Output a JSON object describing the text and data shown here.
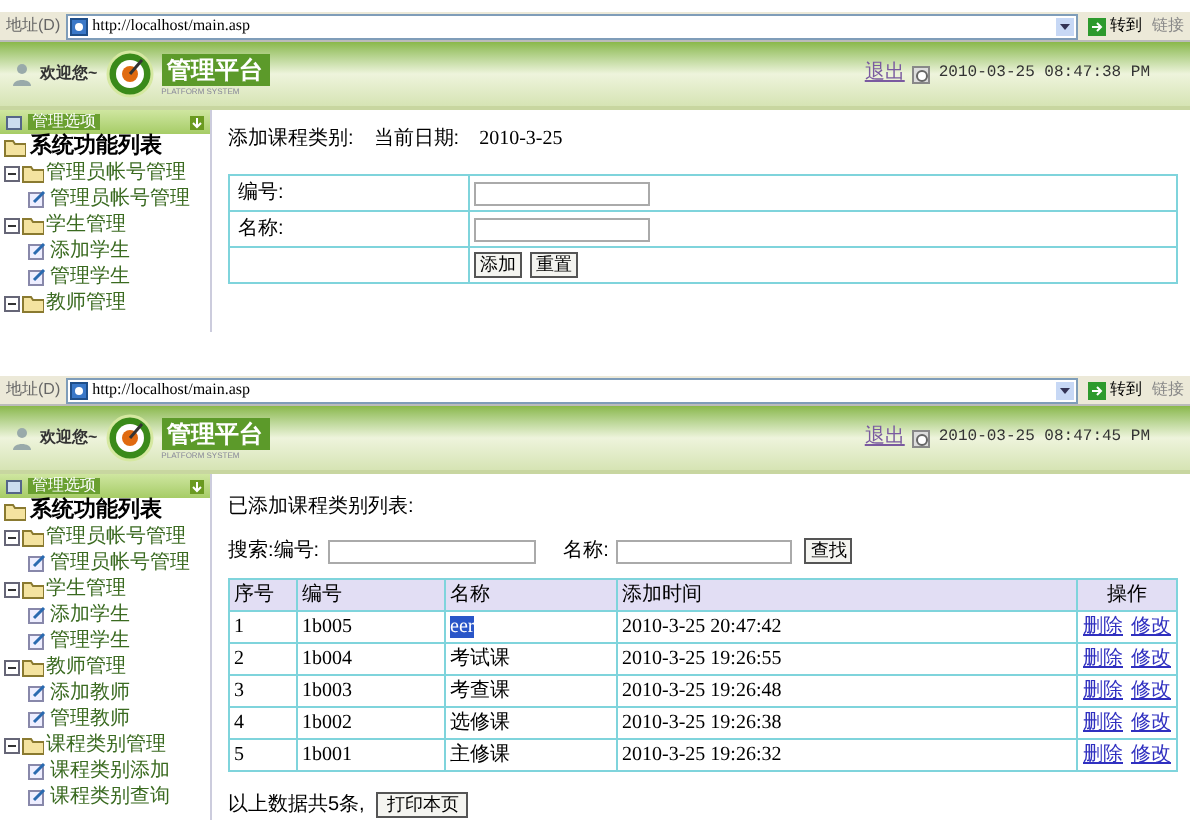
{
  "screens": [
    {
      "address_label": "地址(D)",
      "url": "http://localhost/main.asp",
      "go_label": "转到",
      "links_label": "链接",
      "welcome": "欢迎您~",
      "logo_text": "管理平台",
      "logo_subtitle": "PLATFORM SYSTEM",
      "logout": "退出",
      "datetime": "2010-03-25 08:47:38 PM",
      "sidebar": {
        "header": "管理选项",
        "title": "系统功能列表",
        "groups": [
          {
            "label": "管理员帐号管理",
            "expanded": true,
            "children": [
              {
                "label": "管理员帐号管理"
              }
            ]
          },
          {
            "label": "学生管理",
            "expanded": true,
            "children": [
              {
                "label": "添加学生"
              },
              {
                "label": "管理学生"
              }
            ]
          },
          {
            "label": "教师管理",
            "expanded": true
          }
        ]
      },
      "content": {
        "kind": "form",
        "title": "添加课程类别:",
        "date_label": "当前日期:",
        "date": "2010-3-25",
        "fields": [
          {
            "label": "编号:"
          },
          {
            "label": "名称:"
          }
        ],
        "buttons": [
          "添加",
          "重置"
        ]
      }
    },
    {
      "address_label": "地址(D)",
      "url": "http://localhost/main.asp",
      "go_label": "转到",
      "links_label": "链接",
      "welcome": "欢迎您~",
      "logo_text": "管理平台",
      "logo_subtitle": "PLATFORM SYSTEM",
      "logout": "退出",
      "datetime": "2010-03-25 08:47:45 PM",
      "sidebar": {
        "header": "管理选项",
        "title": "系统功能列表",
        "groups": [
          {
            "label": "管理员帐号管理",
            "expanded": true,
            "children": [
              {
                "label": "管理员帐号管理"
              }
            ]
          },
          {
            "label": "学生管理",
            "expanded": true,
            "children": [
              {
                "label": "添加学生"
              },
              {
                "label": "管理学生"
              }
            ]
          },
          {
            "label": "教师管理",
            "expanded": true,
            "children": [
              {
                "label": "添加教师"
              },
              {
                "label": "管理教师"
              }
            ]
          },
          {
            "label": "课程类别管理",
            "expanded": true,
            "children": [
              {
                "label": "课程类别添加"
              },
              {
                "label": "课程类别查询"
              }
            ]
          }
        ]
      },
      "content": {
        "kind": "list",
        "title": "已添加课程类别列表:",
        "search": {
          "label": "搜索:编号:",
          "label2": "名称:",
          "button": "查找"
        },
        "columns": [
          "序号",
          "编号",
          "名称",
          "添加时间",
          "操作"
        ],
        "rows": [
          {
            "cells": [
              "1",
              "1b005",
              "eer",
              "2010-3-25 20:47:42"
            ],
            "highlighted": true,
            "actions": [
              "删除",
              "修改"
            ]
          },
          {
            "cells": [
              "2",
              "1b004",
              "考试课",
              "2010-3-25 19:26:55"
            ],
            "highlighted": false,
            "actions": [
              "删除",
              "修改"
            ]
          },
          {
            "cells": [
              "3",
              "1b003",
              "考查课",
              "2010-3-25 19:26:48"
            ],
            "highlighted": false,
            "actions": [
              "删除",
              "修改"
            ]
          },
          {
            "cells": [
              "4",
              "1b002",
              "选修课",
              "2010-3-25 19:26:38"
            ],
            "highlighted": false,
            "actions": [
              "删除",
              "修改"
            ]
          },
          {
            "cells": [
              "5",
              "1b001",
              "主修课",
              "2010-3-25 19:26:32"
            ],
            "highlighted": false,
            "actions": [
              "删除",
              "修改"
            ]
          }
        ],
        "footer": "以上数据共5条,",
        "print_button": "打印本页"
      }
    }
  ]
}
